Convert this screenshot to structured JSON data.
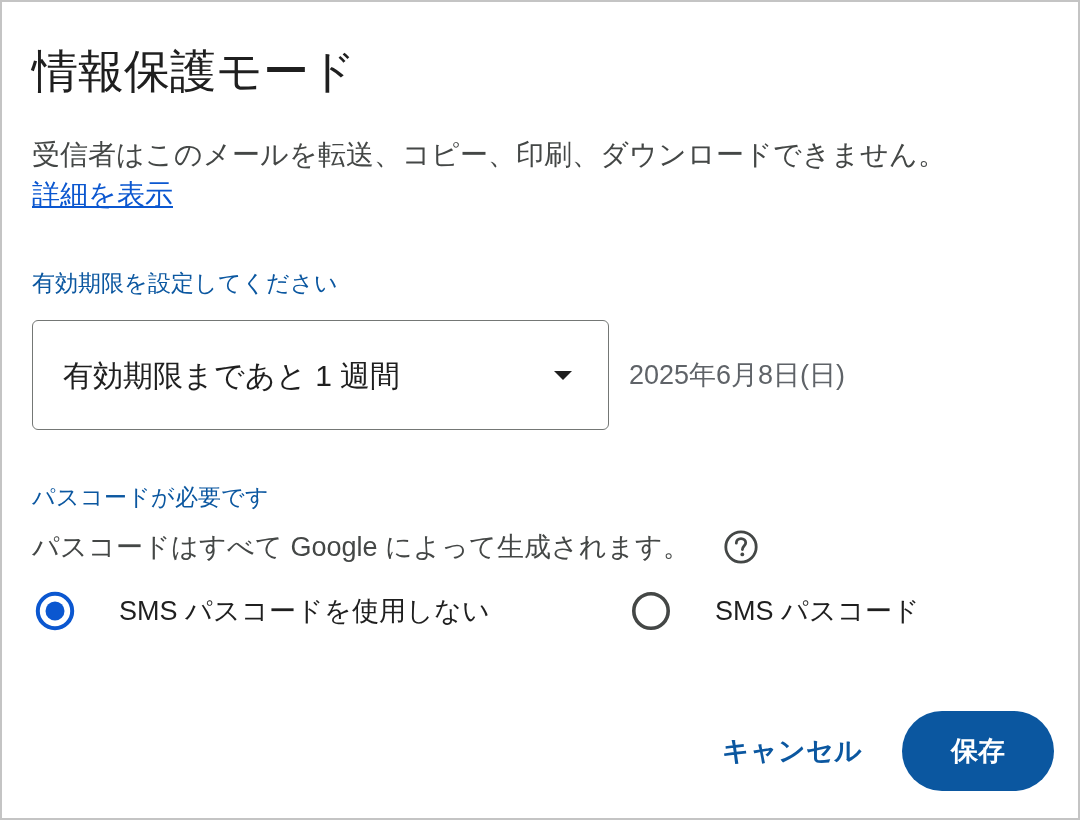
{
  "dialog": {
    "title": "情報保護モード",
    "description": "受信者はこのメールを転送、コピー、印刷、ダウンロードできません。",
    "learn_more_link": "詳細を表示"
  },
  "expiration": {
    "label": "有効期限を設定してください",
    "select": {
      "value": "有効期限まであと 1 週間"
    },
    "date": "2025年6月8日(日)"
  },
  "passcode": {
    "label": "パスコードが必要です",
    "note": "パスコードはすべて Google によって生成されます。",
    "options": [
      {
        "label": "SMS パスコードを使用しない",
        "selected": true
      },
      {
        "label": "SMS パスコード",
        "selected": false
      }
    ]
  },
  "buttons": [
    {
      "label": "キャンセル",
      "kind": "text"
    },
    {
      "label": "保存",
      "kind": "filled"
    }
  ]
}
